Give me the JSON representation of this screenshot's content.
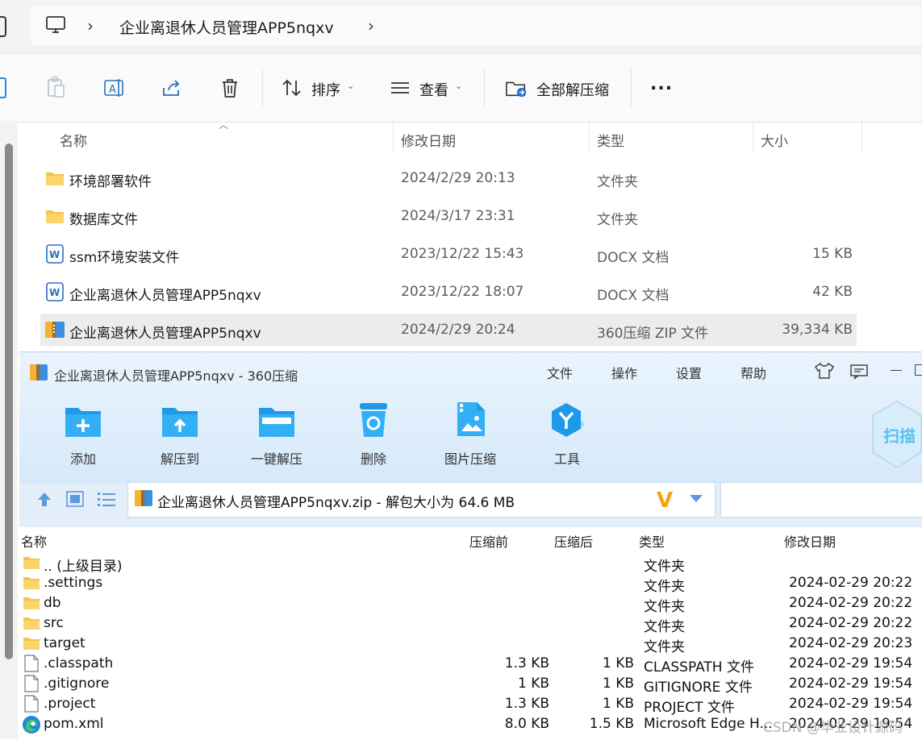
{
  "explorer": {
    "breadcrumb": {
      "folder": "企业离退休人员管理APP5nqxv"
    },
    "toolbar": {
      "sort_label": "排序",
      "view_label": "查看",
      "extract_all_label": "全部解压缩",
      "more_label": "..."
    },
    "columns": {
      "name": "名称",
      "date": "修改日期",
      "type": "类型",
      "size": "大小"
    },
    "files": [
      {
        "name": "环境部署软件",
        "date": "2024/2/29 20:13",
        "type": "文件夹",
        "size": "",
        "icon": "folder-icon"
      },
      {
        "name": "数据库文件",
        "date": "2024/3/17 23:31",
        "type": "文件夹",
        "size": "",
        "icon": "folder-icon"
      },
      {
        "name": "ssm环境安装文件",
        "date": "2023/12/22 15:43",
        "type": "DOCX 文档",
        "size": "15 KB",
        "icon": "word-doc-icon"
      },
      {
        "name": "企业离退休人员管理APP5nqxv",
        "date": "2023/12/22 18:07",
        "type": "DOCX 文档",
        "size": "42 KB",
        "icon": "word-doc-icon"
      },
      {
        "name": "企业离退休人员管理APP5nqxv",
        "date": "2024/2/29 20:24",
        "type": "360压缩 ZIP 文件",
        "size": "39,334 KB",
        "icon": "zip-archive-icon",
        "selected": true
      }
    ]
  },
  "zip_window": {
    "title": "企业离退休人员管理APP5nqxv - 360压缩",
    "menu": [
      "文件",
      "操作",
      "设置",
      "帮助"
    ],
    "buttons": [
      "添加",
      "解压到",
      "一键解压",
      "删除",
      "图片压缩",
      "工具"
    ],
    "scan_label": "扫描",
    "path_text": "企业离退休人员管理APP5nqxv.zip - 解包大小为 64.6 MB",
    "columns": {
      "name": "名称",
      "before": "压缩前",
      "after": "压缩后",
      "type": "类型",
      "date": "修改日期"
    },
    "rows": [
      {
        "name": ".. (上级目录)",
        "before": "",
        "after": "",
        "type": "文件夹",
        "date": "",
        "icon": "folder-icon"
      },
      {
        "name": ".settings",
        "before": "",
        "after": "",
        "type": "文件夹",
        "date": "2024-02-29 20:22",
        "icon": "folder-icon"
      },
      {
        "name": "db",
        "before": "",
        "after": "",
        "type": "文件夹",
        "date": "2024-02-29 20:22",
        "icon": "folder-icon"
      },
      {
        "name": "src",
        "before": "",
        "after": "",
        "type": "文件夹",
        "date": "2024-02-29 20:22",
        "icon": "folder-icon"
      },
      {
        "name": "target",
        "before": "",
        "after": "",
        "type": "文件夹",
        "date": "2024-02-29 20:23",
        "icon": "folder-icon"
      },
      {
        "name": ".classpath",
        "before": "1.3 KB",
        "after": "1 KB",
        "type": "CLASSPATH 文件",
        "date": "2024-02-29 19:54",
        "icon": "file-icon"
      },
      {
        "name": ".gitignore",
        "before": "1 KB",
        "after": "1 KB",
        "type": "GITIGNORE 文件",
        "date": "2024-02-29 19:54",
        "icon": "file-icon"
      },
      {
        "name": ".project",
        "before": "1.3 KB",
        "after": "1 KB",
        "type": "PROJECT 文件",
        "date": "2024-02-29 19:54",
        "icon": "file-icon"
      },
      {
        "name": "pom.xml",
        "before": "8.0 KB",
        "after": "1.5 KB",
        "type": "Microsoft Edge H...",
        "date": "2024-02-29 19:54",
        "icon": "edge-icon"
      }
    ],
    "watermark": "CSDN @毕业设计源码"
  },
  "colors": {
    "folder": "#f4c34a",
    "accent": "#1e88e5",
    "selected_row": "#ececec"
  }
}
